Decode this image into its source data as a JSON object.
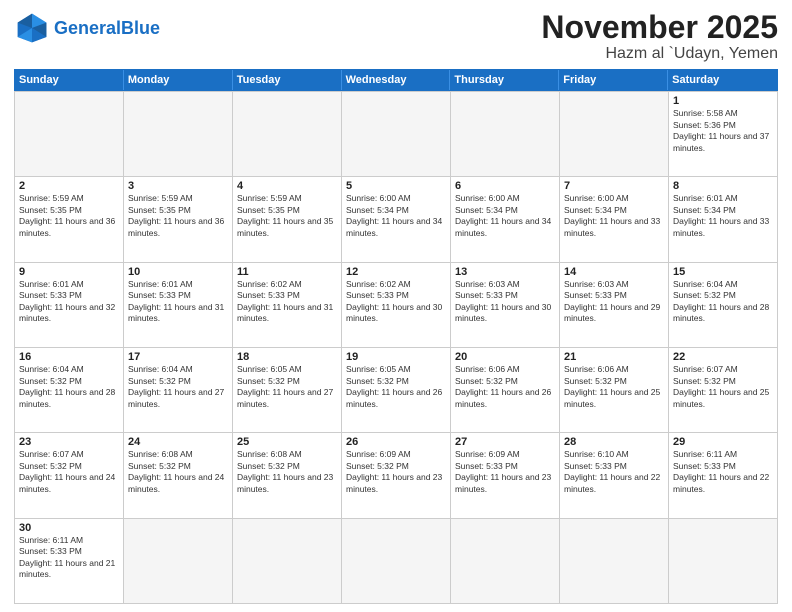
{
  "header": {
    "logo_general": "General",
    "logo_blue": "Blue",
    "month_title": "November 2025",
    "location": "Hazm al `Udayn, Yemen"
  },
  "weekdays": [
    "Sunday",
    "Monday",
    "Tuesday",
    "Wednesday",
    "Thursday",
    "Friday",
    "Saturday"
  ],
  "days": [
    {
      "num": "",
      "empty": true
    },
    {
      "num": "",
      "empty": true
    },
    {
      "num": "",
      "empty": true
    },
    {
      "num": "",
      "empty": true
    },
    {
      "num": "",
      "empty": true
    },
    {
      "num": "",
      "empty": true
    },
    {
      "num": "1",
      "sunrise": "5:58 AM",
      "sunset": "5:36 PM",
      "daylight": "11 hours and 37 minutes."
    },
    {
      "num": "2",
      "sunrise": "5:59 AM",
      "sunset": "5:35 PM",
      "daylight": "11 hours and 36 minutes."
    },
    {
      "num": "3",
      "sunrise": "5:59 AM",
      "sunset": "5:35 PM",
      "daylight": "11 hours and 36 minutes."
    },
    {
      "num": "4",
      "sunrise": "5:59 AM",
      "sunset": "5:35 PM",
      "daylight": "11 hours and 35 minutes."
    },
    {
      "num": "5",
      "sunrise": "6:00 AM",
      "sunset": "5:34 PM",
      "daylight": "11 hours and 34 minutes."
    },
    {
      "num": "6",
      "sunrise": "6:00 AM",
      "sunset": "5:34 PM",
      "daylight": "11 hours and 34 minutes."
    },
    {
      "num": "7",
      "sunrise": "6:00 AM",
      "sunset": "5:34 PM",
      "daylight": "11 hours and 33 minutes."
    },
    {
      "num": "8",
      "sunrise": "6:01 AM",
      "sunset": "5:34 PM",
      "daylight": "11 hours and 33 minutes."
    },
    {
      "num": "9",
      "sunrise": "6:01 AM",
      "sunset": "5:33 PM",
      "daylight": "11 hours and 32 minutes."
    },
    {
      "num": "10",
      "sunrise": "6:01 AM",
      "sunset": "5:33 PM",
      "daylight": "11 hours and 31 minutes."
    },
    {
      "num": "11",
      "sunrise": "6:02 AM",
      "sunset": "5:33 PM",
      "daylight": "11 hours and 31 minutes."
    },
    {
      "num": "12",
      "sunrise": "6:02 AM",
      "sunset": "5:33 PM",
      "daylight": "11 hours and 30 minutes."
    },
    {
      "num": "13",
      "sunrise": "6:03 AM",
      "sunset": "5:33 PM",
      "daylight": "11 hours and 30 minutes."
    },
    {
      "num": "14",
      "sunrise": "6:03 AM",
      "sunset": "5:33 PM",
      "daylight": "11 hours and 29 minutes."
    },
    {
      "num": "15",
      "sunrise": "6:04 AM",
      "sunset": "5:32 PM",
      "daylight": "11 hours and 28 minutes."
    },
    {
      "num": "16",
      "sunrise": "6:04 AM",
      "sunset": "5:32 PM",
      "daylight": "11 hours and 28 minutes."
    },
    {
      "num": "17",
      "sunrise": "6:04 AM",
      "sunset": "5:32 PM",
      "daylight": "11 hours and 27 minutes."
    },
    {
      "num": "18",
      "sunrise": "6:05 AM",
      "sunset": "5:32 PM",
      "daylight": "11 hours and 27 minutes."
    },
    {
      "num": "19",
      "sunrise": "6:05 AM",
      "sunset": "5:32 PM",
      "daylight": "11 hours and 26 minutes."
    },
    {
      "num": "20",
      "sunrise": "6:06 AM",
      "sunset": "5:32 PM",
      "daylight": "11 hours and 26 minutes."
    },
    {
      "num": "21",
      "sunrise": "6:06 AM",
      "sunset": "5:32 PM",
      "daylight": "11 hours and 25 minutes."
    },
    {
      "num": "22",
      "sunrise": "6:07 AM",
      "sunset": "5:32 PM",
      "daylight": "11 hours and 25 minutes."
    },
    {
      "num": "23",
      "sunrise": "6:07 AM",
      "sunset": "5:32 PM",
      "daylight": "11 hours and 24 minutes."
    },
    {
      "num": "24",
      "sunrise": "6:08 AM",
      "sunset": "5:32 PM",
      "daylight": "11 hours and 24 minutes."
    },
    {
      "num": "25",
      "sunrise": "6:08 AM",
      "sunset": "5:32 PM",
      "daylight": "11 hours and 23 minutes."
    },
    {
      "num": "26",
      "sunrise": "6:09 AM",
      "sunset": "5:32 PM",
      "daylight": "11 hours and 23 minutes."
    },
    {
      "num": "27",
      "sunrise": "6:09 AM",
      "sunset": "5:33 PM",
      "daylight": "11 hours and 23 minutes."
    },
    {
      "num": "28",
      "sunrise": "6:10 AM",
      "sunset": "5:33 PM",
      "daylight": "11 hours and 22 minutes."
    },
    {
      "num": "29",
      "sunrise": "6:11 AM",
      "sunset": "5:33 PM",
      "daylight": "11 hours and 22 minutes."
    },
    {
      "num": "30",
      "sunrise": "6:11 AM",
      "sunset": "5:33 PM",
      "daylight": "11 hours and 21 minutes."
    },
    {
      "num": "",
      "empty": true
    },
    {
      "num": "",
      "empty": true
    },
    {
      "num": "",
      "empty": true
    },
    {
      "num": "",
      "empty": true
    },
    {
      "num": "",
      "empty": true
    },
    {
      "num": "",
      "empty": true
    }
  ]
}
